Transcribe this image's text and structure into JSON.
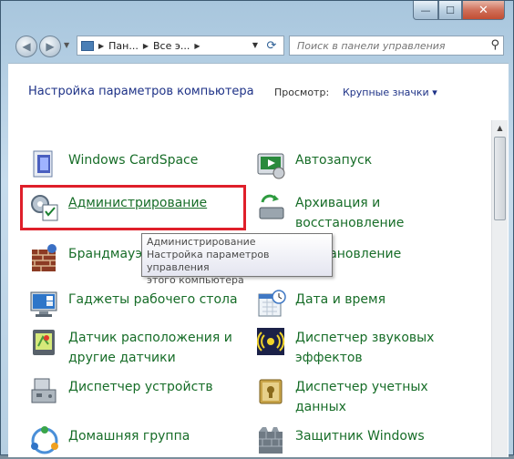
{
  "window": {
    "minimize_label": "—",
    "maximize_label": "☐",
    "close_label": "✕"
  },
  "nav": {
    "back_icon": "◀",
    "forward_icon": "▶",
    "dropdown_icon": "▼",
    "breadcrumbs": [
      "Пан...",
      "Все э..."
    ],
    "sep": "▶",
    "refresh_icon": "⟳",
    "search_placeholder": "Поиск в панели управления",
    "search_icon": "⚲"
  },
  "header": {
    "title": "Настройка параметров компьютера",
    "view_label": "Просмотр:",
    "view_value": "Крупные значки ▾"
  },
  "items": [
    {
      "label": "Windows CardSpace",
      "icon": "cardspace-icon"
    },
    {
      "label": "Автозапуск",
      "icon": "autoplay-icon"
    },
    {
      "label": "Администрирование",
      "icon": "admin-tools-icon"
    },
    {
      "label_line1": "Архивация и",
      "label_line2": "восстановление",
      "icon": "backup-icon"
    },
    {
      "label": "Брандмауэр",
      "icon": "firewall-icon"
    },
    {
      "label": "...становление",
      "icon": "recovery-icon"
    },
    {
      "label": "Гаджеты рабочего стола",
      "icon": "gadgets-icon"
    },
    {
      "label": "Дата и время",
      "icon": "datetime-icon"
    },
    {
      "label_line1": "Датчик расположения и",
      "label_line2": "другие датчики",
      "icon": "sensor-icon"
    },
    {
      "label_line1": "Диспетчер звуковых",
      "label_line2": "эффектов",
      "icon": "sound-icon"
    },
    {
      "label": "Диспетчер устройств",
      "icon": "device-manager-icon"
    },
    {
      "label_line1": "Диспетчер учетных",
      "label_line2": "данных",
      "icon": "credential-manager-icon"
    },
    {
      "label": "Домашняя группа",
      "icon": "homegroup-icon"
    },
    {
      "label": "Защитник Windows",
      "icon": "defender-icon"
    }
  ],
  "tooltip": {
    "line1": "Администрирование",
    "line2": "Настройка параметров управления",
    "line3": "этого компьютера"
  },
  "scrollbar": {
    "up_icon": "▲"
  },
  "colors": {
    "link_green": "#176d28",
    "title_blue": "#1e3287",
    "highlight_red": "#df1f2a"
  }
}
